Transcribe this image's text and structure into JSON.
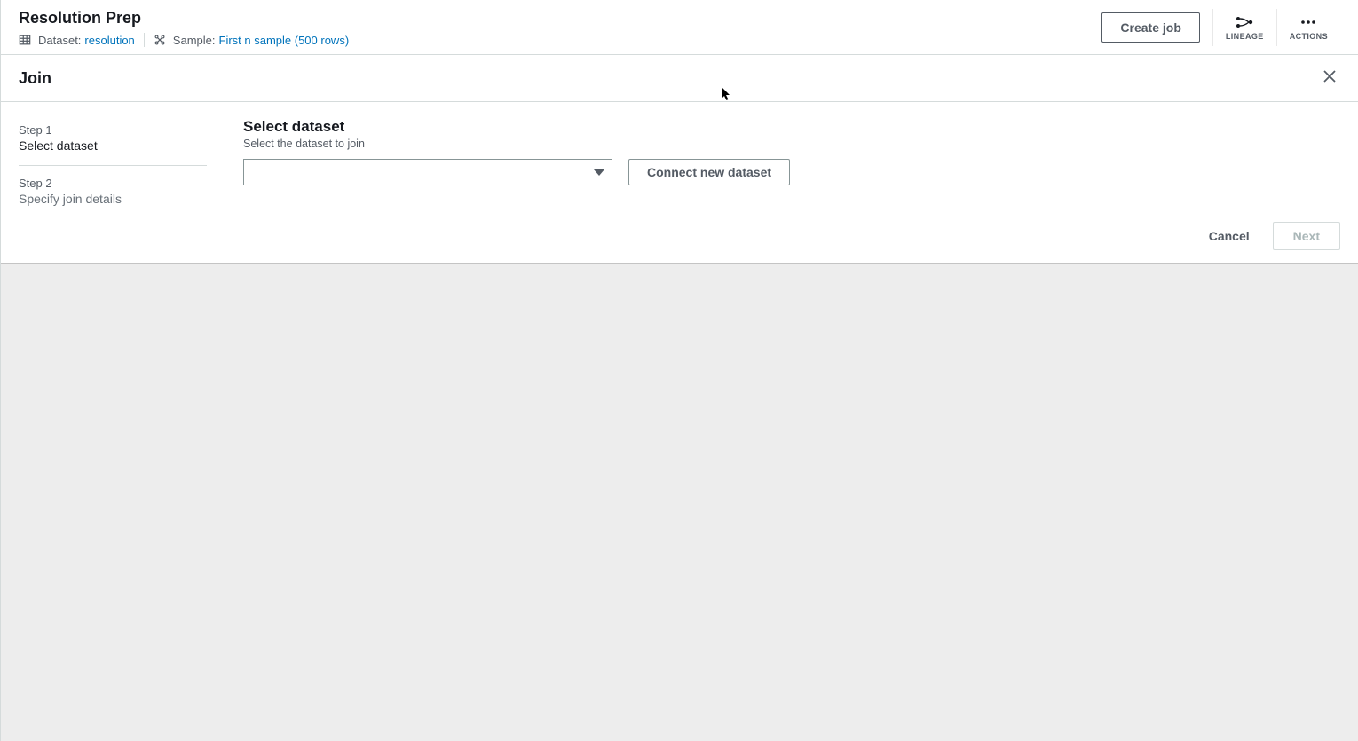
{
  "header": {
    "title": "Resolution Prep",
    "dataset_label": "Dataset:",
    "dataset_link": "resolution",
    "sample_label": "Sample:",
    "sample_link": "First n sample (500 rows)",
    "create_job": "Create job",
    "lineage": "LINEAGE",
    "actions": "ACTIONS"
  },
  "panel": {
    "title": "Join"
  },
  "steps": [
    {
      "label": "Step 1",
      "title": "Select dataset",
      "active": true
    },
    {
      "label": "Step 2",
      "title": "Specify join details",
      "active": false
    }
  ],
  "form": {
    "title": "Select dataset",
    "desc": "Select the dataset to join",
    "select_value": "",
    "connect_btn": "Connect new dataset"
  },
  "footer": {
    "cancel": "Cancel",
    "next": "Next"
  }
}
